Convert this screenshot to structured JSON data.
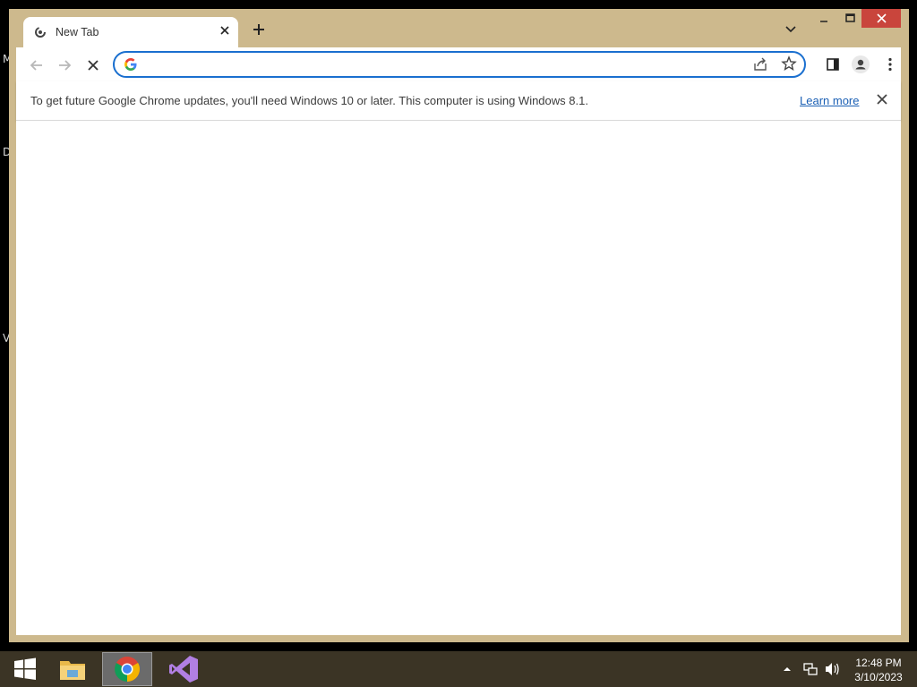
{
  "desktop": {
    "edge_letters": [
      "M",
      "D",
      "V"
    ]
  },
  "window": {
    "controls": {
      "minimize": "‒",
      "maximize": "☐",
      "close": "✕"
    }
  },
  "tab": {
    "title": "New Tab",
    "icon": "chrome-loading-icon",
    "close": "✕"
  },
  "new_tab": "+",
  "toolbar": {
    "back_icon": "back-arrow-icon",
    "forward_icon": "forward-arrow-icon",
    "stop_icon": "stop-icon",
    "omnibox": {
      "value": "",
      "placeholder": ""
    },
    "accent": "#1a6fcf"
  },
  "infobar": {
    "message": "To get future Google Chrome updates, you'll need Windows 10 or later. This computer is using Windows 8.1.",
    "link": "Learn more"
  },
  "taskbar": {
    "apps": [
      "windows-start",
      "file-explorer",
      "google-chrome",
      "visual-studio"
    ],
    "active_app": "google-chrome",
    "clock": {
      "time": "12:48 PM",
      "date": "3/10/2023"
    }
  },
  "colors": {
    "window_frame": "#cdb98d",
    "close_button": "#c9453c",
    "taskbar": "#3b3425"
  }
}
